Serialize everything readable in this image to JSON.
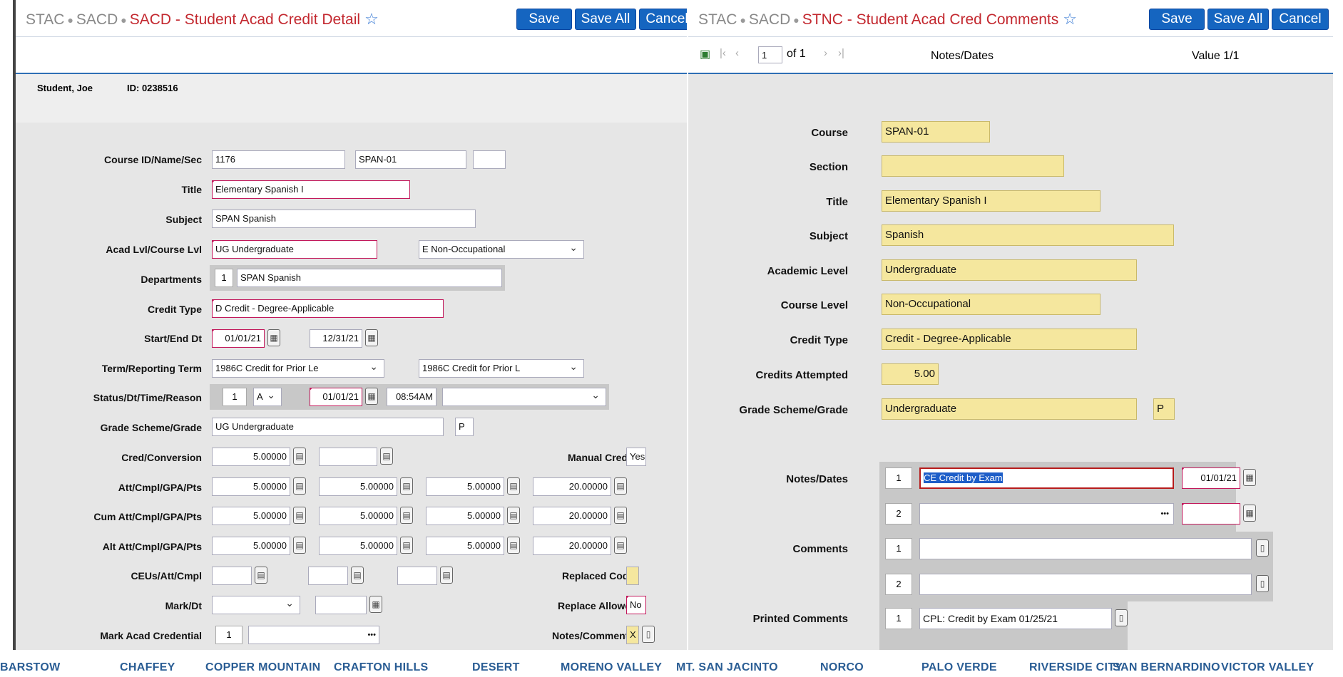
{
  "left": {
    "crumb": {
      "root": "STAC",
      "mid": "SACD",
      "current": "SACD - Student Acad Credit Detail"
    },
    "buttons": {
      "save": "Save",
      "save_all": "Save All",
      "cancel": "Cancel"
    },
    "student": {
      "name": "Student, Joe",
      "id": "ID: 0238516"
    },
    "labels": {
      "course": "Course ID/Name/Sec",
      "title": "Title",
      "subject": "Subject",
      "acad_lvl": "Acad Lvl/Course Lvl",
      "departments": "Departments",
      "credit_type": "Credit Type",
      "start_end": "Start/End Dt",
      "term": "Term/Reporting Term",
      "status": "Status/Dt/Time/Reason",
      "grade": "Grade Scheme/Grade",
      "cred_conv": "Cred/Conversion",
      "att": "Att/Cmpl/GPA/Pts",
      "cum": "Cum Att/Cmpl/GPA/Pts",
      "alt": "Alt Att/Cmpl/GPA/Pts",
      "ceus": "CEUs/Att/Cmpl",
      "mark": "Mark/Dt",
      "mark_cred": "Mark Acad Credential",
      "manual_cred": "Manual Cred",
      "replaced_code": "Replaced Code",
      "replace_allowed": "Replace Allowed",
      "notes_comments": "Notes/Comments"
    },
    "values": {
      "course_id": "1176",
      "course_name": "SPAN-01",
      "course_sec": "",
      "title": "Elementary Spanish I",
      "subject": "SPAN  Spanish",
      "acad_lvl": "UG Undergraduate",
      "course_lvl": "E Non-Occupational",
      "dept_num": "1",
      "dept": "SPAN Spanish",
      "credit_type": "D Credit - Degree-Applicable",
      "start": "01/01/21",
      "end": "12/31/21",
      "term": "1986C Credit for Prior Le",
      "rep_term": "1986C Credit for Prior L",
      "status_num": "1",
      "status": "A",
      "status_dt": "01/01/21",
      "status_time": "08:54AM",
      "grade_scheme": "UG Undergraduate",
      "grade": "P",
      "cred": "5.00000",
      "att": [
        "5.00000",
        "5.00000",
        "5.00000",
        "20.00000"
      ],
      "cum": [
        "5.00000",
        "5.00000",
        "5.00000",
        "20.00000"
      ],
      "alt": [
        "5.00000",
        "5.00000",
        "5.00000",
        "20.00000"
      ],
      "manual_cred": "Yes",
      "replace_allowed": "No",
      "notes": "X",
      "mark_cred_num": "1"
    }
  },
  "right": {
    "crumb": {
      "root": "STAC",
      "mid": "SACD",
      "current": "STNC - Student Acad Cred Comments"
    },
    "buttons": {
      "save": "Save",
      "save_all": "Save All",
      "cancel": "Cancel"
    },
    "pager": {
      "page": "1",
      "of": "of 1",
      "section": "Notes/Dates",
      "value": "Value 1/1"
    },
    "labels": {
      "course": "Course",
      "section": "Section",
      "title": "Title",
      "subject": "Subject",
      "acad_level": "Academic Level",
      "course_level": "Course Level",
      "credit_type": "Credit Type",
      "credits_att": "Credits Attempted",
      "grade": "Grade Scheme/Grade",
      "notes_dates": "Notes/Dates",
      "comments": "Comments",
      "printed_comments": "Printed Comments"
    },
    "values": {
      "course": "SPAN-01",
      "section": "",
      "title": "Elementary Spanish I",
      "subject": "Spanish",
      "acad_level": "Undergraduate",
      "course_level": "Non-Occupational",
      "credit_type": "Credit - Degree-Applicable",
      "credits_att": "5.00",
      "grade_scheme": "Undergraduate",
      "grade": "P",
      "note1": "CE   Credit by Exam",
      "note1_date": "01/01/21",
      "printed1": "CPL: Credit by Exam 01/25/21",
      "n1": "1",
      "n2": "2"
    }
  },
  "footer": [
    "BARSTOW",
    "CHAFFEY",
    "COPPER MOUNTAIN",
    "CRAFTON HILLS",
    "DESERT",
    "MORENO VALLEY",
    "MT. SAN JACINTO",
    "NORCO",
    "PALO VERDE",
    "RIVERSIDE CITY",
    "SAN BERNARDINO",
    "VICTOR VALLEY"
  ]
}
